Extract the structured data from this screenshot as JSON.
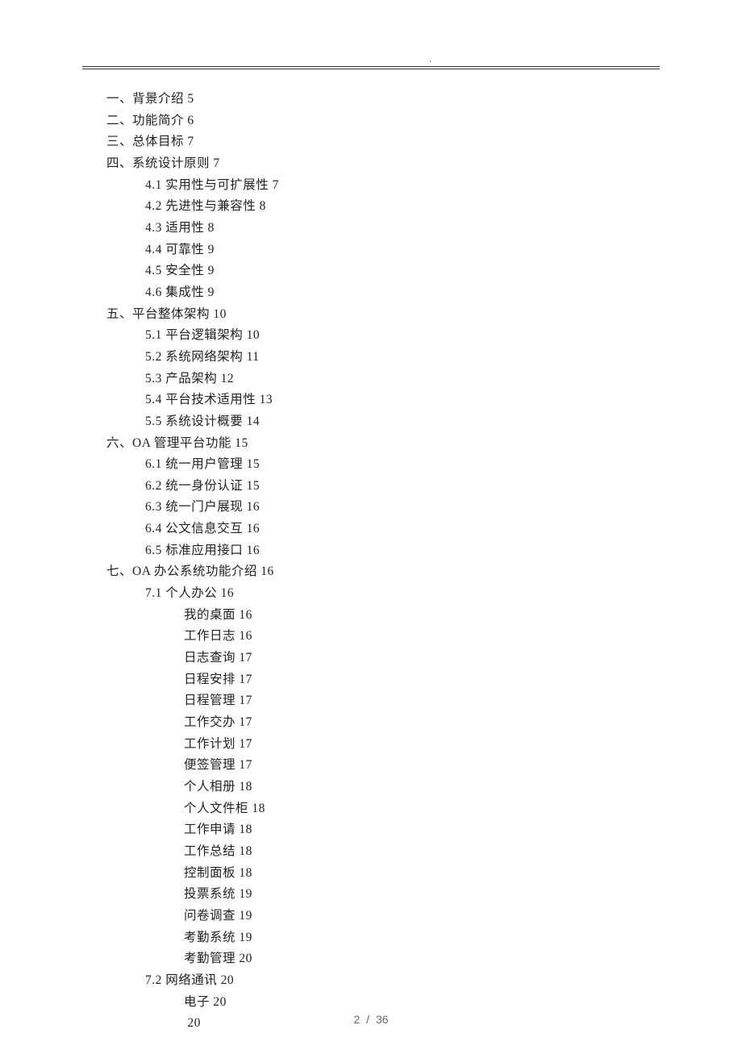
{
  "header_dot": ".",
  "toc": [
    {
      "level": 0,
      "text": "一、背景介绍 5"
    },
    {
      "level": 0,
      "text": "二、功能简介 6"
    },
    {
      "level": 0,
      "text": "三、总体目标 7"
    },
    {
      "level": 0,
      "text": "四、系统设计原则 7"
    },
    {
      "level": 1,
      "text": "4.1 实用性与可扩展性 7"
    },
    {
      "level": 1,
      "text": "4.2 先进性与兼容性 8"
    },
    {
      "level": 1,
      "text": "4.3 适用性 8"
    },
    {
      "level": 1,
      "text": "4.4 可靠性 9"
    },
    {
      "level": 1,
      "text": "4.5 安全性 9"
    },
    {
      "level": 1,
      "text": "4.6 集成性 9"
    },
    {
      "level": 0,
      "text": "五、平台整体架构 10"
    },
    {
      "level": 1,
      "text": "5.1 平台逻辑架构 10"
    },
    {
      "level": 1,
      "text": "5.2 系统网络架构 11"
    },
    {
      "level": 1,
      "text": "5.3 产品架构 12"
    },
    {
      "level": 1,
      "text": "5.4 平台技术适用性 13"
    },
    {
      "level": 1,
      "text": "5.5 系统设计概要 14"
    },
    {
      "level": 0,
      "text": "六、OA 管理平台功能 15"
    },
    {
      "level": 1,
      "text": "6.1 统一用户管理 15"
    },
    {
      "level": 1,
      "text": "6.2 统一身份认证 15"
    },
    {
      "level": 1,
      "text": "6.3 统一门户展现 16"
    },
    {
      "level": 1,
      "text": "6.4 公文信息交互 16"
    },
    {
      "level": 1,
      "text": "6.5 标准应用接口 16"
    },
    {
      "level": 0,
      "text": "七、OA 办公系统功能介绍 16"
    },
    {
      "level": 1,
      "text": "7.1 个人办公 16"
    },
    {
      "level": 2,
      "text": "我的桌面 16"
    },
    {
      "level": 2,
      "text": "工作日志 16"
    },
    {
      "level": 2,
      "text": "日志查询 17"
    },
    {
      "level": 2,
      "text": "日程安排 17"
    },
    {
      "level": 2,
      "text": "日程管理 17"
    },
    {
      "level": 2,
      "text": "工作交办 17"
    },
    {
      "level": 2,
      "text": "工作计划 17"
    },
    {
      "level": 2,
      "text": "便签管理 17"
    },
    {
      "level": 2,
      "text": "个人相册 18"
    },
    {
      "level": 2,
      "text": "个人文件柜 18"
    },
    {
      "level": 2,
      "text": "工作申请 18"
    },
    {
      "level": 2,
      "text": "工作总结 18"
    },
    {
      "level": 2,
      "text": "控制面板 18"
    },
    {
      "level": 2,
      "text": "投票系统 19"
    },
    {
      "level": 2,
      "text": "问卷调查 19"
    },
    {
      "level": 2,
      "text": "考勤系统 19"
    },
    {
      "level": 2,
      "text": "考勤管理 20"
    },
    {
      "level": 1,
      "text": "7.2 网络通讯 20"
    },
    {
      "level": 2,
      "text": "电子 20"
    },
    {
      "level": 2,
      "text": " 20"
    }
  ],
  "footer": {
    "current": "2",
    "sep": "/",
    "total": "36"
  }
}
